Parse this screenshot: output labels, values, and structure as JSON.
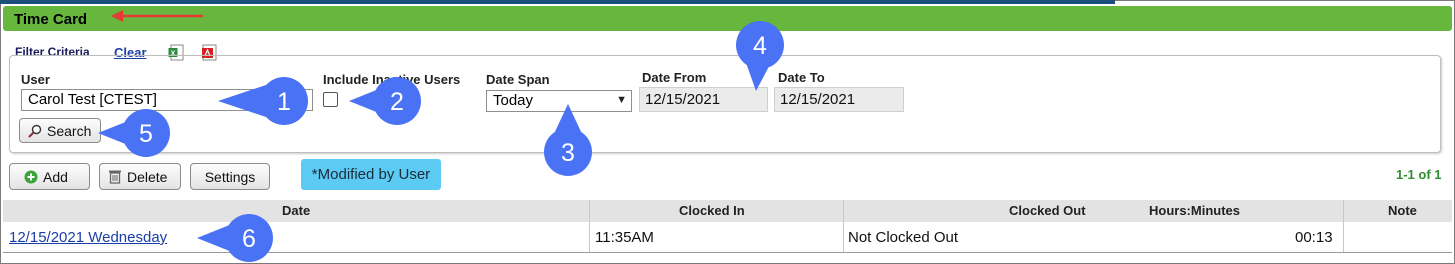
{
  "header": {
    "title": "Time Card"
  },
  "filter": {
    "title": "Filter Criteria",
    "clear_label": "Clear",
    "user_label": "User",
    "user_value": "Carol Test [CTEST]",
    "inactive_label": "Include Inactive Users",
    "inactive_checked": false,
    "datespan_label": "Date Span",
    "datespan_value": "Today",
    "datefrom_label": "Date From",
    "datefrom_value": "12/15/2021",
    "dateto_label": "Date To",
    "dateto_value": "12/15/2021",
    "search_label": "Search"
  },
  "toolbar": {
    "add_label": "Add",
    "delete_label": "Delete",
    "settings_label": "Settings",
    "modified_badge": "*Modified by User",
    "pager": "1-1 of 1"
  },
  "table": {
    "columns": [
      "Date",
      "Clocked In",
      "Clocked Out",
      "Hours:Minutes",
      "Note"
    ],
    "rows": [
      {
        "date": "12/15/2021 Wednesday",
        "clocked_in": "11:35AM",
        "clocked_out": "Not Clocked Out",
        "hours_minutes": "00:13",
        "note": ""
      }
    ]
  },
  "callouts": {
    "c1": "1",
    "c2": "2",
    "c3": "3",
    "c4": "4",
    "c5": "5",
    "c6": "6"
  },
  "colors": {
    "header_green": "#67b73f",
    "callout_blue": "#4a72f5",
    "arrow_red": "#e53935",
    "badge_blue": "#5ccbf3"
  }
}
